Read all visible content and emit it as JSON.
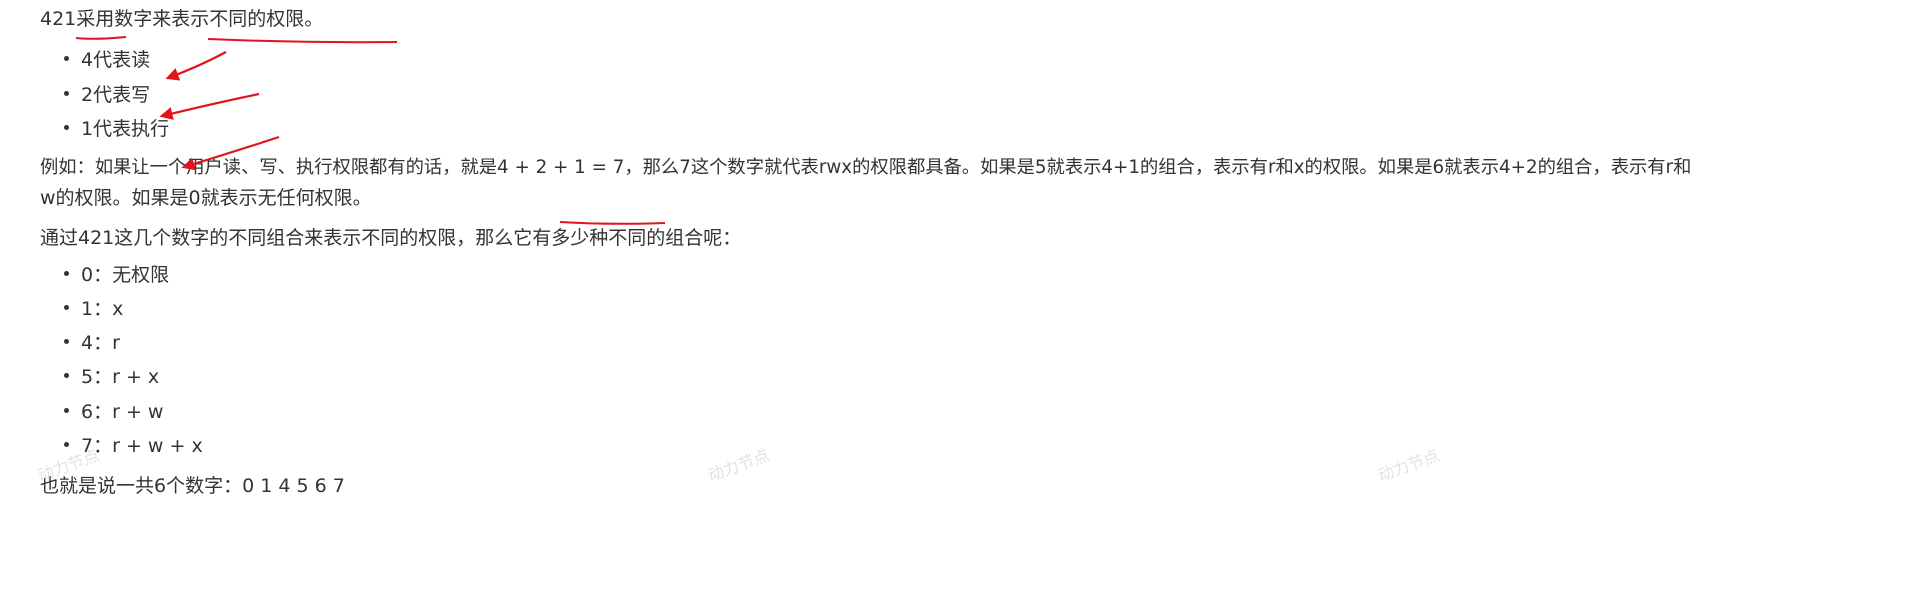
{
  "intro": "421采用数字来表示不同的权限。",
  "meanings": [
    "4代表读",
    "2代表写",
    "1代表执行"
  ],
  "example": {
    "line1": "例如：如果让一个用户读、写、执行权限都有的话，就是4 + 2 + 1 = 7，那么7这个数字就代表rwx的权限都具备。如果是5就表示4+1的组合，表示有r和x的权限。如果是6就表示4+2的组合，表示有r和",
    "line2": "w的权限。如果是0就表示无任何权限。"
  },
  "question": "通过421这几个数字的不同组合来表示不同的权限，那么它有多少种不同的组合呢：",
  "combinations": [
    "0：无权限",
    "1：x",
    "4：r",
    "5：r + x",
    "6：r + w",
    "7：r + w + x"
  ],
  "conclusion": "也就是说一共6个数字：0 1 4 5 6 7",
  "watermarks": [
    "动力节点",
    "动力节点",
    "动力节点"
  ],
  "annotation_color": "#e0141b"
}
